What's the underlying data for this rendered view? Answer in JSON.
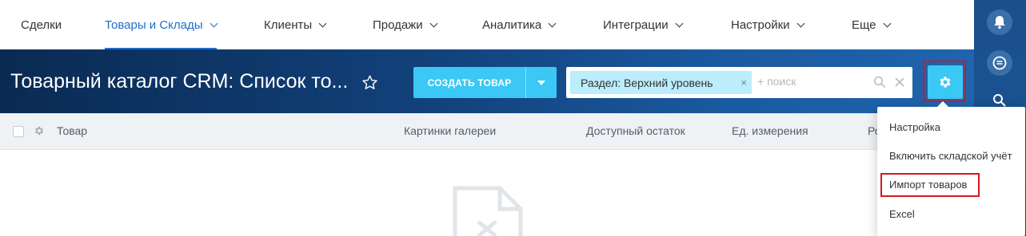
{
  "nav": {
    "items": [
      {
        "label": "Сделки",
        "dropdown": false,
        "active": false
      },
      {
        "label": "Товары и Склады",
        "dropdown": true,
        "active": true
      },
      {
        "label": "Клиенты",
        "dropdown": true,
        "active": false
      },
      {
        "label": "Продажи",
        "dropdown": true,
        "active": false
      },
      {
        "label": "Аналитика",
        "dropdown": true,
        "active": false
      },
      {
        "label": "Интеграции",
        "dropdown": true,
        "active": false
      },
      {
        "label": "Настройки",
        "dropdown": true,
        "active": false
      },
      {
        "label": "Еще",
        "dropdown": true,
        "active": false
      }
    ]
  },
  "header": {
    "title": "Товарный каталог CRM: Список то...",
    "create_button": "СОЗДАТЬ ТОВАР",
    "filter": {
      "chip": "Раздел: Верхний уровень",
      "chip_remove": "×",
      "placeholder": "+ поиск",
      "clear": "×"
    }
  },
  "grid": {
    "columns": [
      "Товар",
      "Картинки галереи",
      "Доступный остаток",
      "Ед. измерения",
      "Ро"
    ]
  },
  "settings_menu": {
    "items": [
      "Настройка",
      "Включить складской учёт",
      "Импорт товаров",
      "Excel"
    ]
  },
  "colors": {
    "accent": "#3bc8f5",
    "active_nav": "#1e6ec8",
    "highlight": "#d4181d"
  }
}
